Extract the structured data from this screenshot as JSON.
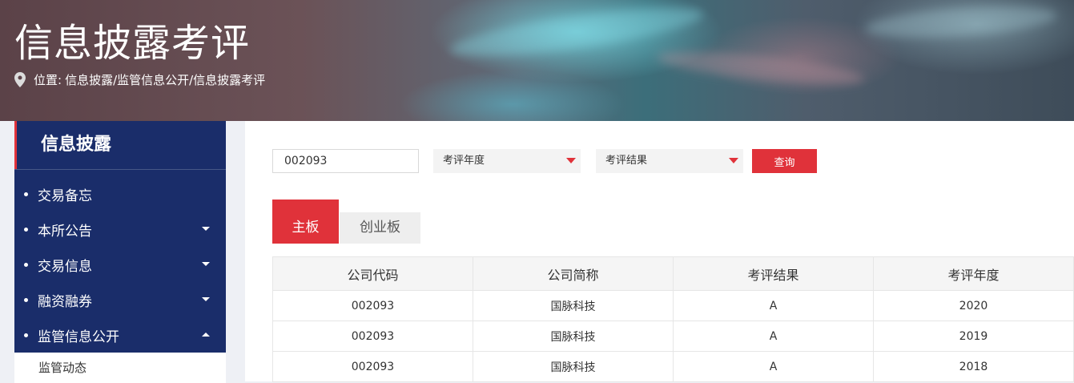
{
  "header": {
    "title": "信息披露考评",
    "location_label": "位置:",
    "breadcrumb": "信息披露/监管信息公开/信息披露考评"
  },
  "sidebar": {
    "title": "信息披露",
    "items": [
      {
        "label": "交易备忘",
        "caret": "none"
      },
      {
        "label": "本所公告",
        "caret": "down"
      },
      {
        "label": "交易信息",
        "caret": "down"
      },
      {
        "label": "融资融券",
        "caret": "down"
      },
      {
        "label": "监管信息公开",
        "caret": "up"
      }
    ],
    "sub_items": [
      {
        "label": "监管动态"
      }
    ]
  },
  "filters": {
    "code_value": "002093",
    "year_placeholder": "考评年度",
    "result_placeholder": "考评结果",
    "query_label": "查询"
  },
  "tabs": [
    {
      "label": "主板",
      "active": true
    },
    {
      "label": "创业板",
      "active": false
    }
  ],
  "table": {
    "headers": [
      "公司代码",
      "公司简称",
      "考评结果",
      "考评年度"
    ],
    "rows": [
      [
        "002093",
        "国脉科技",
        "A",
        "2020"
      ],
      [
        "002093",
        "国脉科技",
        "A",
        "2019"
      ],
      [
        "002093",
        "国脉科技",
        "A",
        "2018"
      ]
    ]
  },
  "colors": {
    "accent": "#e0323a",
    "sidebar_bg": "#1a2d6a"
  },
  "icons": {
    "location": "map-pin-icon"
  }
}
